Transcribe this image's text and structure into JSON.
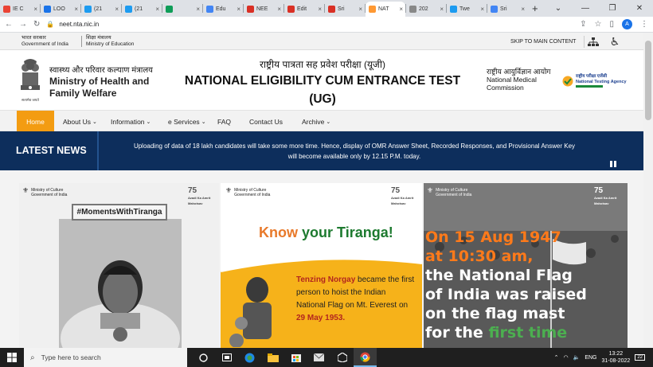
{
  "browser": {
    "tabs": [
      {
        "label": "IE C",
        "color": "#ea4335"
      },
      {
        "label": "LOO",
        "color": "#1a73e8"
      },
      {
        "label": "(21",
        "color": "#1d9bf0"
      },
      {
        "label": "(21",
        "color": "#1d9bf0"
      },
      {
        "label": "",
        "color": "#0f9d58"
      },
      {
        "label": "Edu",
        "color": "#4285f4"
      },
      {
        "label": "NEE",
        "color": "#d93025"
      },
      {
        "label": "Edit",
        "color": "#d93025"
      },
      {
        "label": "Sri",
        "color": "#d93025"
      },
      {
        "label": "NAT",
        "color": "#ff9933"
      },
      {
        "label": "202",
        "color": "#888888"
      },
      {
        "label": "Twe",
        "color": "#1d9bf0"
      },
      {
        "label": "Sri",
        "color": "#4285f4"
      }
    ],
    "active_tab_index": 9,
    "url": "neet.nta.nic.in",
    "profile_initial": "A"
  },
  "gov_bar": {
    "gov_hi": "भारत सरकार",
    "gov_en": "Government of India",
    "moe_hi": "शिक्षा मंत्रालय",
    "moe_en": "Ministry of Education",
    "skip": "SKIP TO MAIN CONTENT"
  },
  "header": {
    "emblem_caption": "सत्यमेव जयते",
    "ministry_hi": "स्वास्थ्य और परिवार कल्याण मंत्रालय",
    "ministry_en_1": "Ministry of Health and",
    "ministry_en_2": "Family Welfare",
    "title_hi": "राष्ट्रीय पात्रता सह प्रवेश परीक्षा (यूजी)",
    "title_en_1": "NATIONAL ELIGIBILITY CUM ENTRANCE TEST",
    "title_en_2": "(UG)",
    "nmc_hi": "राष्ट्रीय आयुर्विज्ञान आयोग",
    "nmc_en_1": "National Medical",
    "nmc_en_2": "Commission",
    "nta_hi": "राष्ट्रीय परीक्षा एजेंसी",
    "nta_en": "National Testing Agency"
  },
  "nav": {
    "items": [
      "Home",
      "About Us",
      "Information",
      "e Services",
      "FAQ",
      "Contact Us",
      "Archive"
    ]
  },
  "news": {
    "label": "LATEST NEWS",
    "text_1": "Uploading of data of 18 lakh candidates will take some more time. Hence, display of OMR Answer Sheet, Recorded Responses, and Provisional Answer Key",
    "text_2": "will become available only by 12.15 P.M. today."
  },
  "banner": {
    "moc_1": "Ministry of Culture",
    "moc_2": "Government of India",
    "azadi": "Azadi Ka Amrit Mahotsav",
    "p1_tag": "#MomentsWithTiranga",
    "p2_title_1": "Know",
    "p2_title_2": "your Tiranga!",
    "p2_name": "Tenzing Norgay",
    "p2_text": "became the first person to hoist the Indian National Flag on Mt. Everest on",
    "p2_date": "29 May 1953.",
    "p3_line1": "On 15 Aug 1947",
    "p3_line2": "at 10:30 am,",
    "p3_line3": "the National Flag",
    "p3_line4": "of India was raised",
    "p3_line5": "on the flag mast",
    "p3_line6a": "for the",
    "p3_line6b": "first time"
  },
  "taskbar": {
    "search_placeholder": "Type here to search",
    "lang": "ENG",
    "time": "13:22",
    "date": "31-08-2022",
    "notif_count": "22"
  }
}
